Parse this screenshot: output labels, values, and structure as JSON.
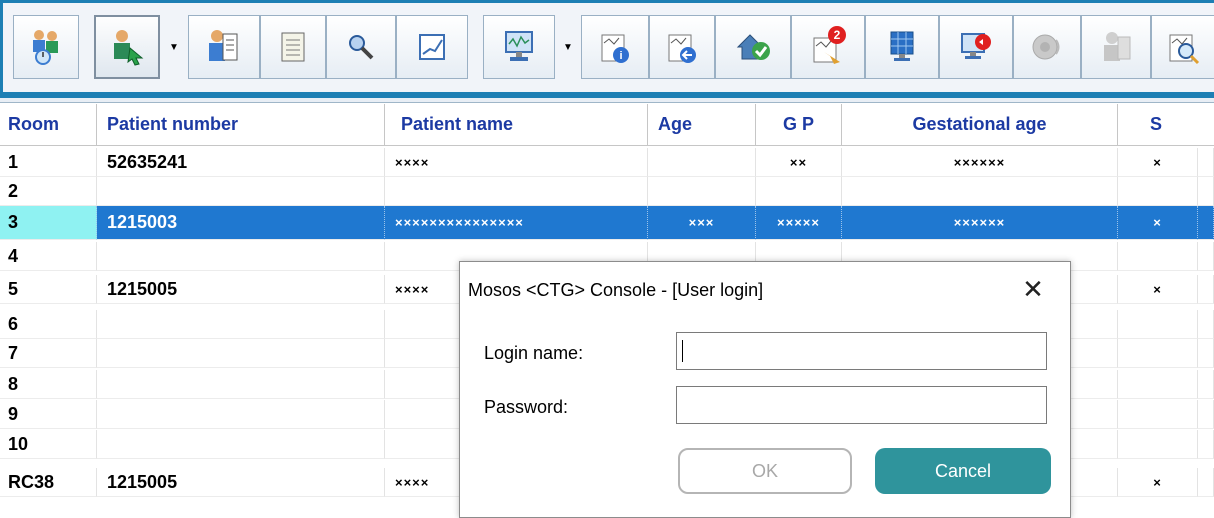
{
  "toolbar": {
    "icons": [
      "bed-patients-icon",
      "patient-arrow-icon",
      "patient-document-icon",
      "notepad-icon",
      "search-key-icon",
      "chart-icon",
      "monitor-icon",
      "trace-info-icon",
      "trace-back-icon",
      "home-check-icon",
      "alerts-icon",
      "grid-monitor-icon",
      "monitor-sound-off-icon",
      "speaker-icon",
      "person-disabled-icon",
      "trace-search-icon"
    ],
    "alert_count": "2",
    "accent_color": "#1d7fb4"
  },
  "table": {
    "headers": {
      "room": "Room",
      "patient_number": "Patient number",
      "patient_name": "Patient name",
      "age": "Age",
      "gp": "G P",
      "gestational_age": "Gestational age",
      "s": "S"
    },
    "rows": [
      {
        "room": "1",
        "patient_number": "52635241",
        "patient_name": "××××",
        "age": "",
        "gp": "××",
        "gestational_age": "××××××",
        "s": "×"
      },
      {
        "room": "2",
        "patient_number": "",
        "patient_name": "",
        "age": "",
        "gp": "",
        "gestational_age": "",
        "s": ""
      },
      {
        "room": "3",
        "patient_number": "1215003",
        "patient_name": "×××××××××××××××",
        "age": "×××",
        "gp": "×××××",
        "gestational_age": "××××××",
        "s": "×"
      },
      {
        "room": "4",
        "patient_number": "",
        "patient_name": "",
        "age": "",
        "gp": "",
        "gestational_age": "",
        "s": ""
      },
      {
        "room": "5",
        "patient_number": "1215005",
        "patient_name": "××××",
        "age": "",
        "gp": "",
        "gestational_age": "",
        "s": "×"
      },
      {
        "room": "6",
        "patient_number": "",
        "patient_name": "",
        "age": "",
        "gp": "",
        "gestational_age": "",
        "s": ""
      },
      {
        "room": "7",
        "patient_number": "",
        "patient_name": "",
        "age": "",
        "gp": "",
        "gestational_age": "",
        "s": ""
      },
      {
        "room": "8",
        "patient_number": "",
        "patient_name": "",
        "age": "",
        "gp": "",
        "gestational_age": "",
        "s": ""
      },
      {
        "room": "9",
        "patient_number": "",
        "patient_name": "",
        "age": "",
        "gp": "",
        "gestational_age": "",
        "s": ""
      },
      {
        "room": "10",
        "patient_number": "",
        "patient_name": "",
        "age": "",
        "gp": "",
        "gestational_age": "",
        "s": ""
      },
      {
        "room": "RC38",
        "patient_number": "1215005",
        "patient_name": "××××",
        "age": "",
        "gp": "",
        "gestational_age": "",
        "s": "×"
      }
    ],
    "selected_row_color": "#1f78d0",
    "selected_room_color": "#8ff2f2"
  },
  "dialog": {
    "title": "Mosos <CTG> Console - [User login]",
    "close_icon": "close-icon",
    "login_label": "Login name:",
    "login_value": "",
    "password_label": "Password:",
    "password_value": "",
    "ok_label": "OK",
    "cancel_label": "Cancel",
    "cancel_color": "#2f949c"
  }
}
